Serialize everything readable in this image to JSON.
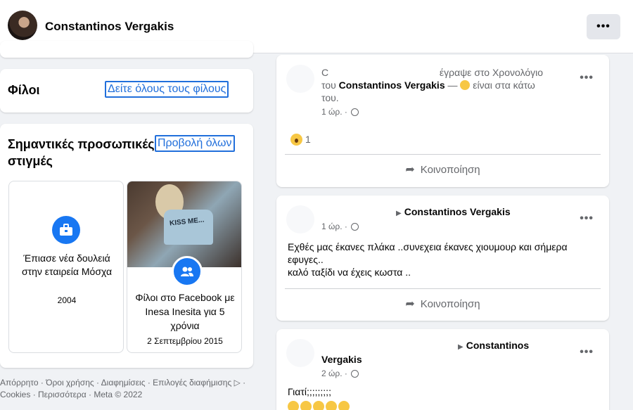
{
  "header": {
    "profile_name": "Constantinos Vergakis",
    "more_label": "•••"
  },
  "left": {
    "friends": {
      "title": "Φίλοι",
      "see_all": "Δείτε όλους τους φίλους"
    },
    "life_events": {
      "title": "Σημαντικές προσωπικές στιγμές",
      "see_all": "Προβολή όλων",
      "events": [
        {
          "text": "Έπιασε νέα δουλειά στην εταιρεία Μόσχα",
          "date": "2004",
          "icon": "briefcase-icon"
        },
        {
          "text": "Φίλοι στο Facebook με Inesa Inesita για 5 χρόνια",
          "date": "2 Σεπτεμβρίου 2015",
          "icon": "friends-icon",
          "photo_text": "KISS ME..."
        }
      ]
    },
    "footer": "Απόρρητο · Όροι χρήσης · Διαφημίσεις · Επιλογές διαφήμισης ▷ · Cookies · Περισσότερα · Meta © 2022"
  },
  "feed": {
    "post1": {
      "head_a": "C",
      "head_b": "έγραψε στο Χρονολόγιο",
      "head_c": "του",
      "name": "Constantinos Vergakis",
      "head_d": "— ",
      "head_e": " είναι στα κάτω",
      "head_f": "του.",
      "time": "1 ώρ. · ",
      "reaction_count": "1",
      "share": "Κοινοποίηση"
    },
    "post2": {
      "name": "Constantinos Vergakis",
      "time": "1 ώρ. · ",
      "text_line1": "Εχθές μας έκανες πλάκα ..συνεχεια έκανες χιουμουρ και σήμερα εφυγες..",
      "text_line2": "καλό ταξίδι να έχεις κωστα ..",
      "share": "Κοινοποίηση"
    },
    "post3": {
      "name_a": "Constantinos",
      "name_b": "Vergakis",
      "time": "2 ώρ. · ",
      "text": "Γιατί;;;;;;;;;"
    },
    "more_label": "•••"
  },
  "colors": {
    "accent": "#1877f2",
    "link": "#216fdb",
    "background": "#f0f2f5"
  }
}
